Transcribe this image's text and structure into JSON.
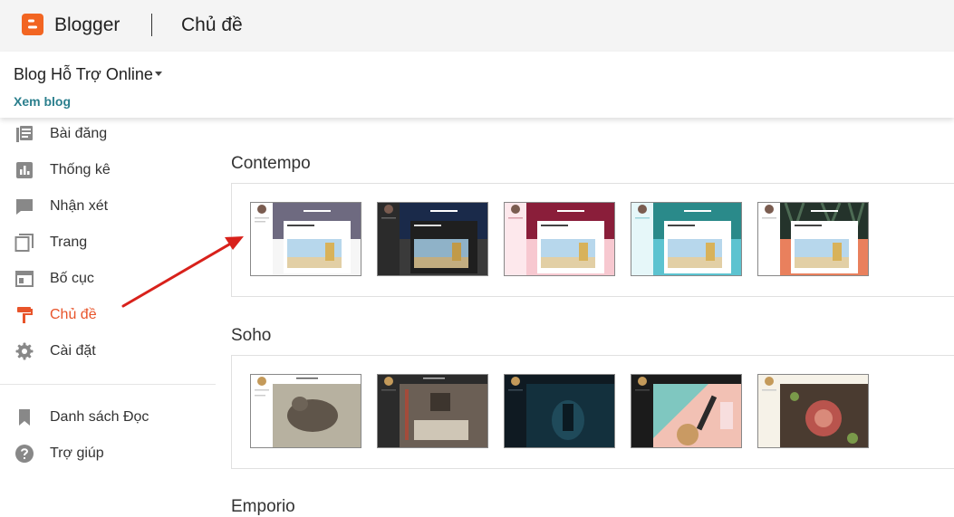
{
  "app": {
    "name": "Blogger",
    "page_title": "Chủ đề"
  },
  "blog": {
    "name": "Blog Hỗ Trợ Online",
    "view_link": "Xem blog"
  },
  "sidebar": {
    "items": [
      {
        "label": "Bài đăng",
        "icon": "posts-icon"
      },
      {
        "label": "Thống kê",
        "icon": "stats-icon"
      },
      {
        "label": "Nhận xét",
        "icon": "comments-icon"
      },
      {
        "label": "Trang",
        "icon": "pages-icon"
      },
      {
        "label": "Bố cục",
        "icon": "layout-icon"
      },
      {
        "label": "Chủ đề",
        "icon": "theme-paint-roller-icon",
        "active": true
      },
      {
        "label": "Cài đặt",
        "icon": "settings-gear-icon"
      }
    ],
    "secondary": [
      {
        "label": "Danh sách Đọc",
        "icon": "bookmark-icon"
      },
      {
        "label": "Trợ giúp",
        "icon": "help-icon"
      }
    ]
  },
  "sections": [
    {
      "title": "Contempo"
    },
    {
      "title": "Soho"
    },
    {
      "title": "Emporio"
    }
  ],
  "colors": {
    "accent": "#e8542a",
    "link": "#2b7f8d",
    "logo": "#f26522",
    "contempo_variants": [
      "#ffffff",
      "#2b2b2b",
      "#f7c8d0",
      "#5cc3d0",
      "#e9805d"
    ],
    "contempo_headers": [
      "#6e6a80",
      "#1a2a4a",
      "#8a1e3a",
      "#2a8a8a",
      "#24332b"
    ]
  }
}
